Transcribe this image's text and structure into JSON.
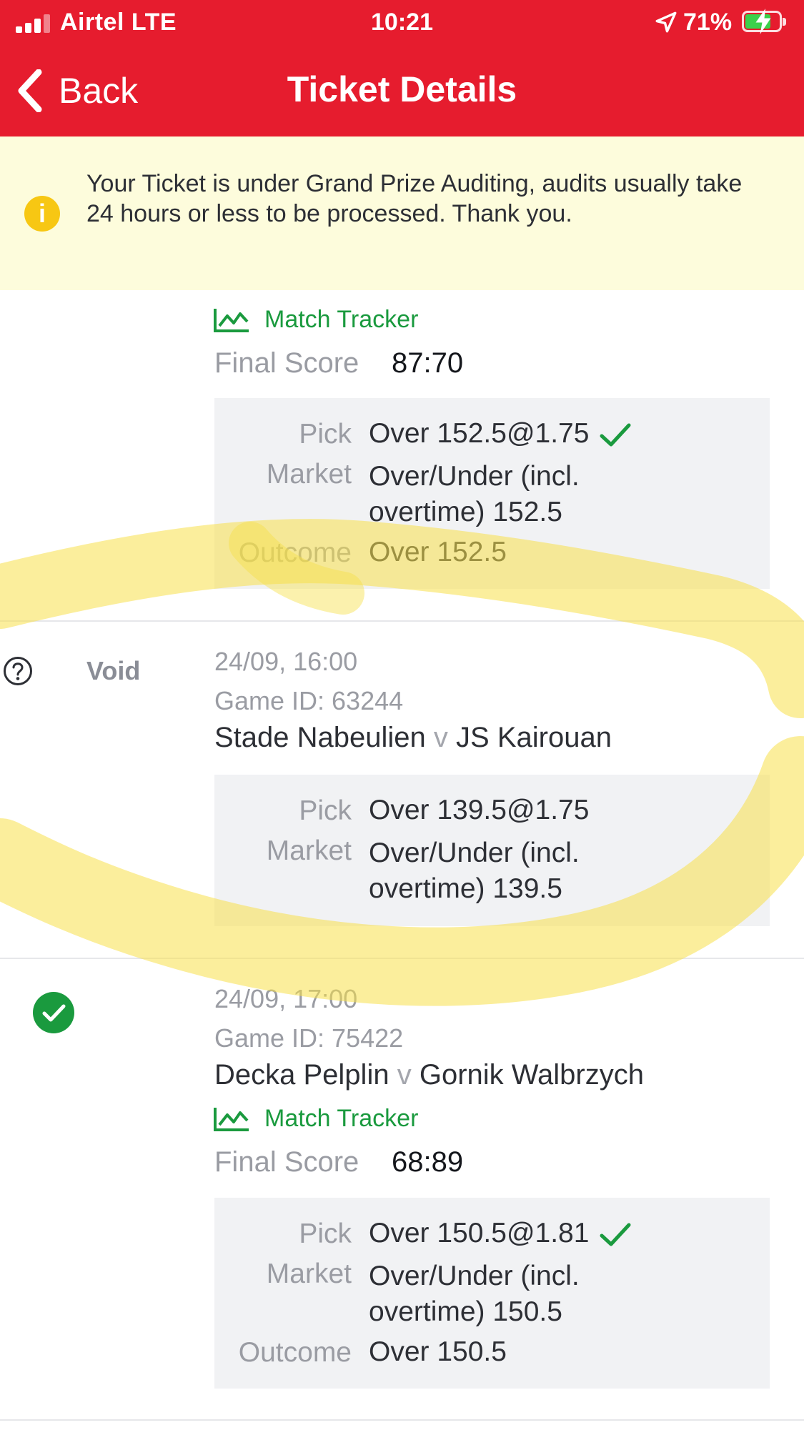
{
  "status_bar": {
    "carrier": "Airtel  LTE",
    "time": "10:21",
    "battery": "71%"
  },
  "header": {
    "back_label": "Back",
    "title": "Ticket Details"
  },
  "banner": {
    "message": "Your Ticket is under Grand Prize Auditing, audits usually take 24 hours or less to be processed. Thank you."
  },
  "match1": {
    "tracker_label": "Match Tracker",
    "final_score_label": "Final Score",
    "final_score": "87:70",
    "pick_label": "Pick",
    "pick": "Over 152.5@1.75",
    "market_label": "Market",
    "market_line1": "Over/Under (incl.",
    "market_line2": "overtime) 152.5",
    "outcome_label": "Outcome",
    "outcome": "Over 152.5"
  },
  "match2": {
    "status": "Void",
    "datetime": "24/09, 16:00",
    "game_id": "Game ID: 63244",
    "home": "Stade Nabeulien",
    "vs": "v",
    "away": "JS Kairouan",
    "pick_label": "Pick",
    "pick": "Over 139.5@1.75",
    "market_label": "Market",
    "market_line1": "Over/Under (incl.",
    "market_line2": "overtime) 139.5"
  },
  "match3": {
    "datetime": "24/09, 17:00",
    "game_id": "Game ID: 75422",
    "home": "Decka Pelplin",
    "vs": "v",
    "away": "Gornik Walbrzych",
    "tracker_label": "Match Tracker",
    "final_score_label": "Final Score",
    "final_score": "68:89",
    "pick_label": "Pick",
    "pick": "Over 150.5@1.81",
    "market_label": "Market",
    "market_line1": "Over/Under (incl.",
    "market_line2": "overtime) 150.5",
    "outcome_label": "Outcome",
    "outcome": "Over 150.5"
  },
  "colors": {
    "header_red": "#e61c2e",
    "banner_bg": "#fdfcdc",
    "tracker_green": "#1a9a3e",
    "highlight_yellow": "#f7e04a"
  },
  "icons": [
    "signal-icon",
    "location-arrow-icon",
    "battery-icon",
    "back-chevron-icon",
    "info-icon",
    "match-tracker-icon",
    "check-icon",
    "question-icon",
    "won-check-icon"
  ]
}
